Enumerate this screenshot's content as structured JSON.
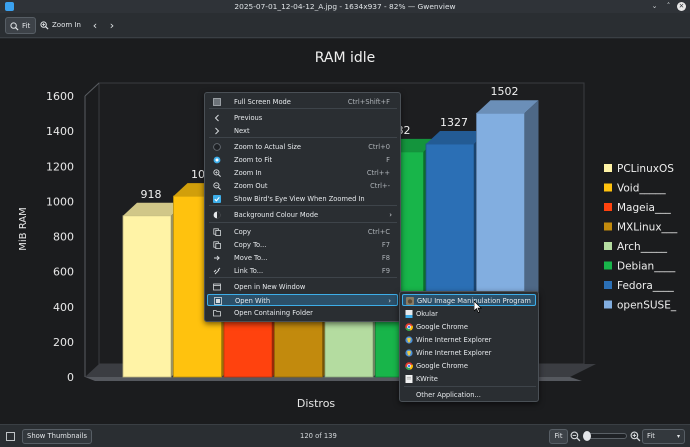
{
  "window": {
    "title": "2025-07-01_12-04-12_A.jpg - 1634x937 - 82% — Gwenview",
    "minimize_glyph": "⌄",
    "maximize_glyph": "˄",
    "close_glyph": "✕"
  },
  "toolbar": {
    "fit_label": "Fit",
    "zoom_in_label": "Zoom In",
    "back_glyph": "‹",
    "forward_glyph": "›"
  },
  "chart_data": {
    "type": "bar",
    "title": "RAM idle",
    "xlabel": "Distros",
    "ylabel": "MiB RAM",
    "ylim": [
      0,
      1600
    ],
    "yticks": [
      "0",
      "200",
      "400",
      "600",
      "800",
      "1000",
      "1200",
      "1400",
      "1600"
    ],
    "categories": [
      "PCLinuxOS",
      "Void_____",
      "Mageia___",
      "MXLinux___",
      "Arch_____",
      "Debian____",
      "Fedora____",
      "openSUSE_"
    ],
    "values": [
      918,
      1030,
      1050,
      1060,
      1140,
      1282,
      1327,
      1502
    ],
    "data_labels": [
      "918",
      "103",
      "",
      "",
      "",
      "82",
      "1327",
      "1502"
    ],
    "colors": [
      "#fff3a6",
      "#ffc20e",
      "#ff420e",
      "#c28a0d",
      "#b4dca0",
      "#18b54a",
      "#2b6fb5",
      "#82aee0"
    ],
    "legend_position": "right"
  },
  "context_menu": {
    "items": [
      {
        "label": "Full Screen Mode",
        "shortcut": "Ctrl+Shift+F",
        "icon": "fullscreen-icon"
      },
      {
        "label": "Previous",
        "shortcut": "",
        "icon": "chevron-left-icon"
      },
      {
        "label": "Next",
        "shortcut": "",
        "icon": "chevron-right-icon"
      },
      {
        "label": "Zoom to Actual Size",
        "shortcut": "Ctrl+0",
        "icon": "radio-off-icon"
      },
      {
        "label": "Zoom to Fit",
        "shortcut": "F",
        "icon": "radio-on-icon"
      },
      {
        "label": "Zoom In",
        "shortcut": "Ctrl++",
        "icon": "zoom-in-icon"
      },
      {
        "label": "Zoom Out",
        "shortcut": "Ctrl+-",
        "icon": "zoom-out-icon"
      },
      {
        "label": "Show Bird's Eye View When Zoomed In",
        "shortcut": "",
        "icon": "checkbox-checked-icon"
      },
      {
        "label": "Background Colour Mode",
        "shortcut": "",
        "icon": "color-mode-icon"
      },
      {
        "label": "Copy",
        "shortcut": "Ctrl+C",
        "icon": "copy-icon"
      },
      {
        "label": "Copy To...",
        "shortcut": "F7",
        "icon": "copy-to-icon"
      },
      {
        "label": "Move To...",
        "shortcut": "F8",
        "icon": "move-to-icon"
      },
      {
        "label": "Link To...",
        "shortcut": "F9",
        "icon": "link-icon"
      },
      {
        "label": "Open in New Window",
        "shortcut": "",
        "icon": "new-window-icon"
      },
      {
        "label": "Open With",
        "shortcut": "",
        "icon": "open-with-icon"
      },
      {
        "label": "Open Containing Folder",
        "shortcut": "",
        "icon": "folder-icon"
      }
    ],
    "submenu_arrow": "›"
  },
  "open_with_submenu": {
    "items": [
      {
        "label": "GNU Image Manipulation Program",
        "icon": "gimp-icon"
      },
      {
        "label": "Okular",
        "icon": "okular-icon"
      },
      {
        "label": "Google Chrome",
        "icon": "chrome-icon"
      },
      {
        "label": "Wine Internet Explorer",
        "icon": "wine-icon"
      },
      {
        "label": "Wine Internet Explorer",
        "icon": "wine-icon"
      },
      {
        "label": "Google Chrome",
        "icon": "chrome-icon"
      },
      {
        "label": "KWrite",
        "icon": "kwrite-icon"
      },
      {
        "label": "Other Application...",
        "icon": ""
      }
    ]
  },
  "statusbar": {
    "show_thumbnails_label": "Show Thumbnails",
    "position_text": "120 of 139",
    "fit_label": "Fit",
    "zoom_mode_value": "Fit",
    "zoom_slider_fraction": 0.05
  },
  "colors": {
    "accent": "#3daee9",
    "highlight_fill": "#2c5069",
    "chart_background": "#1d1f22"
  }
}
